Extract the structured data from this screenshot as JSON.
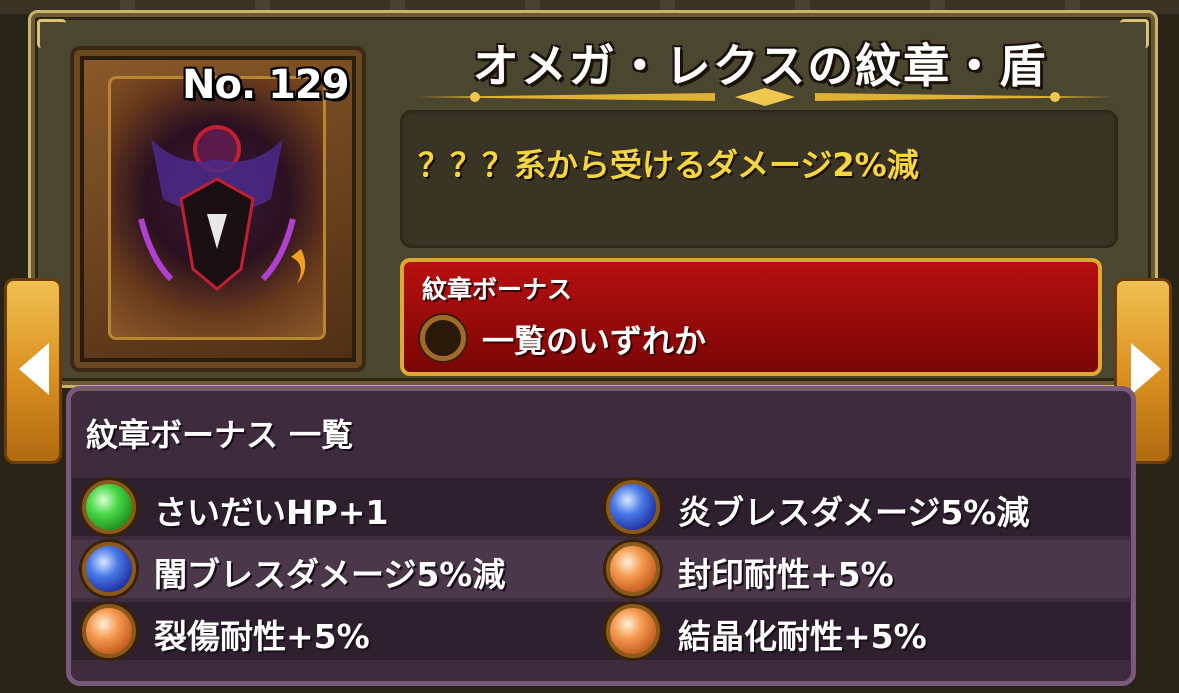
{
  "header": {
    "number": "No. 129",
    "title": "オメガ・レクスの紋章・盾",
    "description": "？？？系から受けるダメージ2%減"
  },
  "bonus": {
    "label": "紋章ボーナス",
    "value": "一覧のいずれか"
  },
  "list": {
    "title": "紋章ボーナス 一覧",
    "items": [
      {
        "text": "さいだいHP+1",
        "orb": "green-orb-icon"
      },
      {
        "text": "炎ブレスダメージ5%減",
        "orb": "blue-orb-icon"
      },
      {
        "text": "闇ブレスダメージ5%減",
        "orb": "blue-orb-icon"
      },
      {
        "text": "封印耐性+5%",
        "orb": "orange-orb-icon"
      },
      {
        "text": "裂傷耐性+5%",
        "orb": "orange-orb-icon"
      },
      {
        "text": "結晶化耐性+5%",
        "orb": "orange-orb-icon"
      }
    ]
  },
  "colors": {
    "description_text": "#f6d640",
    "bonus_bg": "#b81010",
    "list_panel": "#3e2c3e"
  }
}
